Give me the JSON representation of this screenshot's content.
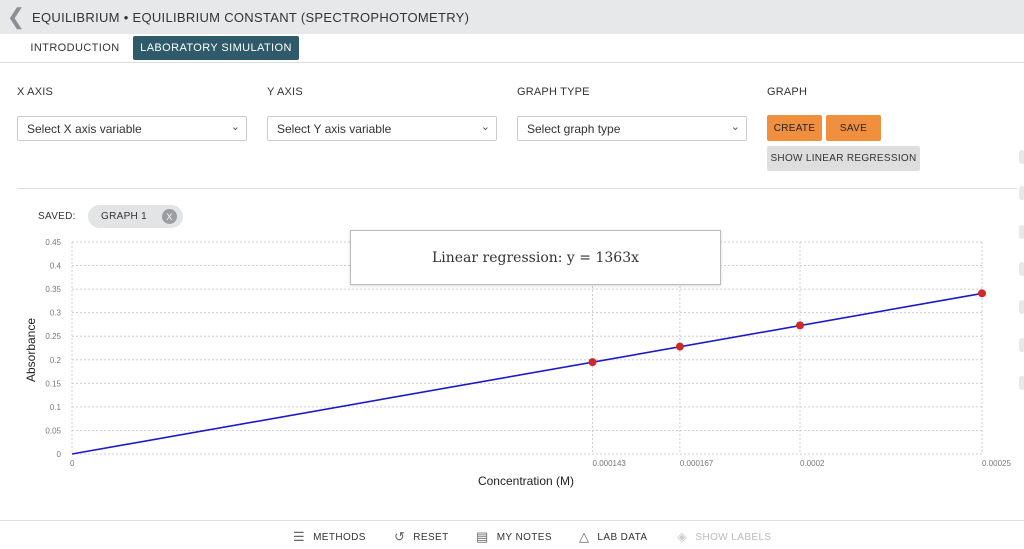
{
  "header": {
    "title": "EQUILIBRIUM • EQUILIBRIUM CONSTANT (SPECTROPHOTOMETRY)"
  },
  "tabs": [
    {
      "label": "INTRODUCTION",
      "active": false
    },
    {
      "label": "LABORATORY SIMULATION",
      "active": true
    }
  ],
  "controls": {
    "x_axis": {
      "label": "X AXIS",
      "value": "Select X axis variable"
    },
    "y_axis": {
      "label": "Y AXIS",
      "value": "Select Y axis variable"
    },
    "graph_type": {
      "label": "GRAPH TYPE",
      "value": "Select graph type"
    },
    "graph": {
      "label": "GRAPH",
      "create": "CREATE",
      "save": "SAVE",
      "regression": "SHOW LINEAR REGRESSION"
    }
  },
  "saved": {
    "label": "SAVED:",
    "chip": "GRAPH 1",
    "chip_close": "X"
  },
  "regression_text": "Linear regression: y = 1363x",
  "chart_data": {
    "type": "scatter",
    "xlabel": "Concentration (M)",
    "ylabel": "Absorbance",
    "x_ticks": [
      "0",
      "0.000143",
      "0.000167",
      "0.0002",
      "0.00025"
    ],
    "x_tick_values": [
      0,
      0.000143,
      0.000167,
      0.0002,
      0.00025
    ],
    "y_ticks": [
      "0",
      "0.05",
      "0.1",
      "0.15",
      "0.2",
      "0.25",
      "0.3",
      "0.35",
      "0.4",
      "0.45"
    ],
    "xlim": [
      0,
      0.00025
    ],
    "ylim": [
      0,
      0.45
    ],
    "points": [
      {
        "x": 0.000143,
        "y": 0.195
      },
      {
        "x": 0.000167,
        "y": 0.228
      },
      {
        "x": 0.0002,
        "y": 0.273
      },
      {
        "x": 0.00025,
        "y": 0.341
      }
    ],
    "regression": {
      "slope": 1363
    },
    "colors": {
      "line": "#1a1acc",
      "points": "#cc2a2a",
      "grid": "#cfcfcf"
    },
    "grid": true
  },
  "footer": [
    {
      "label": "METHODS",
      "icon": "list-icon",
      "enabled": true
    },
    {
      "label": "RESET",
      "icon": "reset-icon",
      "enabled": true
    },
    {
      "label": "MY NOTES",
      "icon": "notes-icon",
      "enabled": true
    },
    {
      "label": "LAB DATA",
      "icon": "flask-icon",
      "enabled": true
    },
    {
      "label": "SHOW LABELS",
      "icon": "tag-icon",
      "enabled": false
    }
  ]
}
